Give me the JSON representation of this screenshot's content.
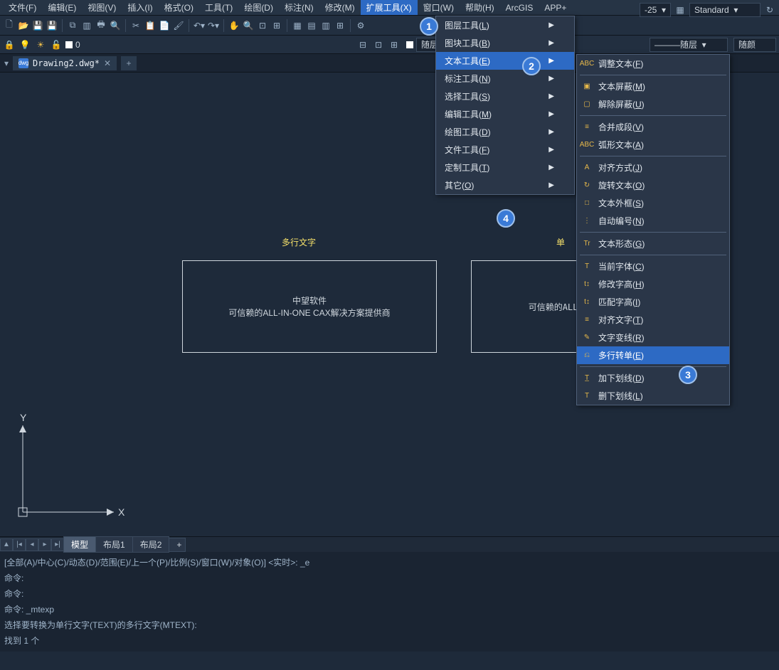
{
  "menubar": [
    "文件(F)",
    "编辑(E)",
    "视图(V)",
    "插入(I)",
    "格式(O)",
    "工具(T)",
    "绘图(D)",
    "标注(N)",
    "修改(M)",
    "扩展工具(X)",
    "窗口(W)",
    "帮助(H)",
    "ArcGIS",
    "APP+"
  ],
  "menubar_highlight": 9,
  "toolbar_right": {
    "style_num": "-25",
    "standard": "Standard"
  },
  "layerbar": {
    "follow": "随层",
    "follow2": "随层",
    "follow3": "随颜",
    "zero": "0"
  },
  "filetab": {
    "name": "Drawing2.dwg*"
  },
  "canvas": {
    "label1": "多行文字",
    "label2": "单",
    "box1_line1": "中望软件",
    "box1_line2": "可信赖的ALL-IN-ONE CAX解决方案提供商",
    "box2_line1": "",
    "box2_line2": "可信赖的ALL-IN-",
    "axis_x": "X",
    "axis_y": "Y"
  },
  "tabs": {
    "model": "模型",
    "layout1": "布局1",
    "layout2": "布局2",
    "add": "+"
  },
  "cmd": [
    "[全部(A)/中心(C)/动态(D)/范围(E)/上一个(P)/比例(S)/窗口(W)/对象(O)] <实时>: _e",
    "命令:",
    "命令:",
    "命令: _mtexp",
    "选择要转换为单行文字(TEXT)的多行文字(MTEXT):",
    "找到 1 个"
  ],
  "menu1": [
    {
      "t": "图层工具(<u>L</u>)",
      "a": true
    },
    {
      "t": "图块工具(<u>B</u>)",
      "a": true
    },
    {
      "t": "文本工具(<u>E</u>)",
      "a": true,
      "hl": true
    },
    {
      "t": "标注工具(<u>N</u>)",
      "a": true
    },
    {
      "t": "选择工具(<u>S</u>)",
      "a": true
    },
    {
      "t": "编辑工具(<u>M</u>)",
      "a": true
    },
    {
      "t": "绘图工具(<u>D</u>)",
      "a": true
    },
    {
      "t": "文件工具(<u>F</u>)",
      "a": true
    },
    {
      "t": "定制工具(<u>T</u>)",
      "a": true
    },
    {
      "t": "其它(<u>O</u>)",
      "a": true
    }
  ],
  "menu2": [
    {
      "t": "调整文本(<u>F</u>)",
      "ic": "ABC"
    },
    {
      "div": true
    },
    {
      "t": "文本屏蔽(<u>M</u>)",
      "ic": "▣"
    },
    {
      "t": "解除屏蔽(<u>U</u>)",
      "ic": "▢"
    },
    {
      "div": true
    },
    {
      "t": "合并成段(<u>V</u>)",
      "ic": "≡"
    },
    {
      "t": "弧形文本(<u>A</u>)",
      "ic": "ABC"
    },
    {
      "div": true
    },
    {
      "t": "对齐方式(<u>J</u>)",
      "ic": "A"
    },
    {
      "t": "旋转文本(<u>O</u>)",
      "ic": "↻"
    },
    {
      "t": "文本外框(<u>S</u>)",
      "ic": "□"
    },
    {
      "t": "自动编号(<u>N</u>)",
      "ic": "⋮"
    },
    {
      "div": true
    },
    {
      "t": "文本形态(<u>G</u>)",
      "ic": "Tr"
    },
    {
      "div": true
    },
    {
      "t": "当前字体(<u>C</u>)",
      "ic": "T"
    },
    {
      "t": "修改字高(<u>H</u>)",
      "ic": "t↕"
    },
    {
      "t": "匹配字高(<u>I</u>)",
      "ic": "t↕"
    },
    {
      "t": "对齐文字(<u>T</u>)",
      "ic": "≡"
    },
    {
      "t": "文字变线(<u>R</u>)",
      "ic": "✎"
    },
    {
      "t": "多行转单(<u>E</u>)",
      "ic": "⎌",
      "hl": true
    },
    {
      "div": true
    },
    {
      "t": "加下划线(<u>D</u>)",
      "ic": "T̲"
    },
    {
      "t": "删下划线(<u>L</u>)",
      "ic": "T"
    }
  ],
  "badges": {
    "b1": "1",
    "b2": "2",
    "b3": "3",
    "b4": "4"
  }
}
